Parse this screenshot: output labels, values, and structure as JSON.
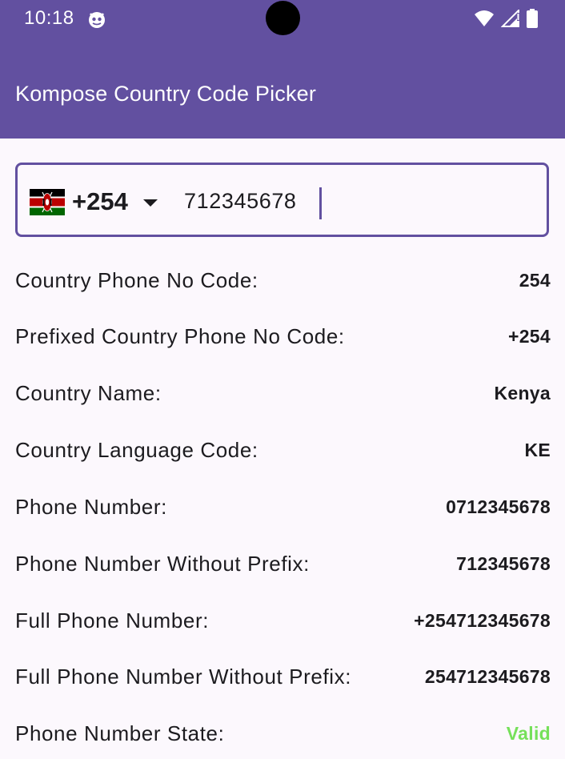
{
  "status_bar": {
    "time": "10:18",
    "icons": [
      "app-notification-icon",
      "wifi-icon",
      "signal-icon",
      "battery-icon"
    ]
  },
  "app_bar": {
    "title": "Kompose Country Code Picker",
    "color": "#6250a0"
  },
  "phone_field": {
    "country_flag": "kenya-flag",
    "country_code": "+254",
    "phone_value": "712345678"
  },
  "info": [
    {
      "label": "Country Phone No Code:",
      "value": "254"
    },
    {
      "label": "Prefixed Country Phone No Code:",
      "value": "+254"
    },
    {
      "label": "Country Name:",
      "value": "Kenya"
    },
    {
      "label": "Country Language Code:",
      "value": "KE"
    },
    {
      "label": "Phone Number:",
      "value": "0712345678"
    },
    {
      "label": "Phone Number Without Prefix:",
      "value": "712345678"
    },
    {
      "label": "Full Phone Number:",
      "value": "+254712345678"
    },
    {
      "label": "Full Phone Number Without Prefix:",
      "value": "254712345678"
    },
    {
      "label": "Phone Number State:",
      "value": "Valid"
    }
  ],
  "colors": {
    "accent": "#6250a0",
    "valid": "#76e05a",
    "background": "#fcf8fd"
  }
}
